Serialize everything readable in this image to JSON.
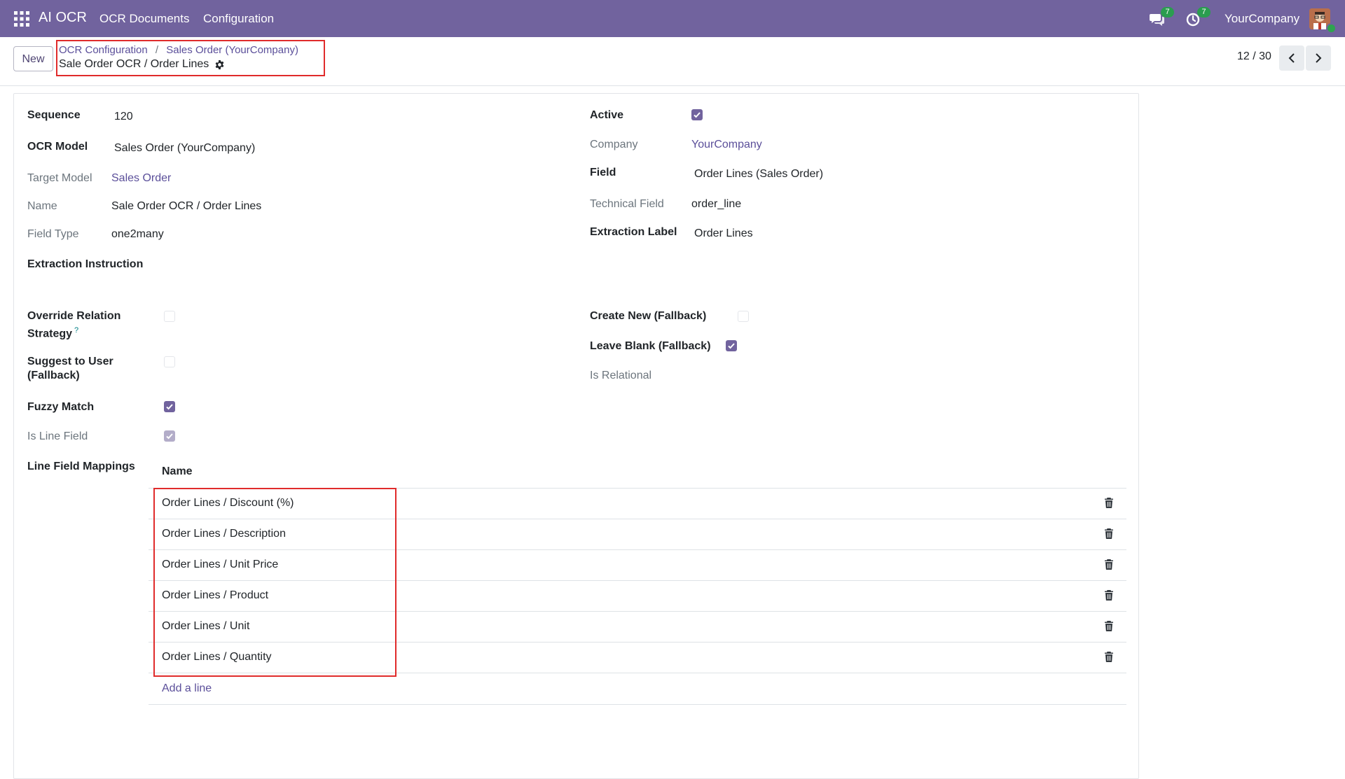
{
  "navbar": {
    "app_name": "AI OCR",
    "menu": [
      "OCR Documents",
      "Configuration"
    ],
    "messages_badge": "7",
    "activities_badge": "7",
    "company": "YourCompany",
    "bg_color": "#71639e"
  },
  "control_panel": {
    "new_label": "New",
    "breadcrumb": [
      "OCR Configuration",
      "Sales Order (YourCompany)"
    ],
    "breadcrumb_separator": "/",
    "record_title": "Sale Order OCR / Order Lines",
    "pager": "12 / 30"
  },
  "form": {
    "left": {
      "sequence_label": "Sequence",
      "sequence_value": "120",
      "ocr_model_label": "OCR Model",
      "ocr_model_value": "Sales Order (YourCompany)",
      "target_model_label": "Target Model",
      "target_model_value": "Sales Order",
      "name_label": "Name",
      "name_value": "Sale Order OCR / Order Lines",
      "field_type_label": "Field Type",
      "field_type_value": "one2many",
      "extraction_instruction_label": "Extraction Instruction",
      "override_label_1": "Override Relation",
      "override_label_2": "Strategy",
      "override_help": "?",
      "override_checked": false,
      "suggest_label_1": "Suggest to User",
      "suggest_label_2": "(Fallback)",
      "suggest_checked": false,
      "fuzzy_label": "Fuzzy Match",
      "fuzzy_checked": true,
      "is_line_label": "Is Line Field",
      "is_line_checked": true,
      "line_mappings_label": "Line Field Mappings"
    },
    "right": {
      "active_label": "Active",
      "active_checked": true,
      "company_label": "Company",
      "company_value": "YourCompany",
      "field_label": "Field",
      "field_value": "Order Lines (Sales Order)",
      "technical_field_label": "Technical Field",
      "technical_field_value": "order_line",
      "extraction_label_label": "Extraction Label",
      "extraction_label_value": "Order Lines",
      "create_new_label": "Create New (Fallback)",
      "create_new_checked": false,
      "leave_blank_label": "Leave Blank (Fallback)",
      "leave_blank_checked": true,
      "is_relational_label": "Is Relational"
    }
  },
  "line_mappings": {
    "column_name": "Name",
    "rows": [
      "Order Lines / Discount (%)",
      "Order Lines / Description",
      "Order Lines / Unit Price",
      "Order Lines / Product",
      "Order Lines / Unit",
      "Order Lines / Quantity"
    ],
    "add_line_label": "Add a line"
  },
  "colors": {
    "accent": "#71639e",
    "link": "#5b4f9a",
    "highlight_box": "#e02b2b",
    "badge": "#2a9d4f"
  }
}
